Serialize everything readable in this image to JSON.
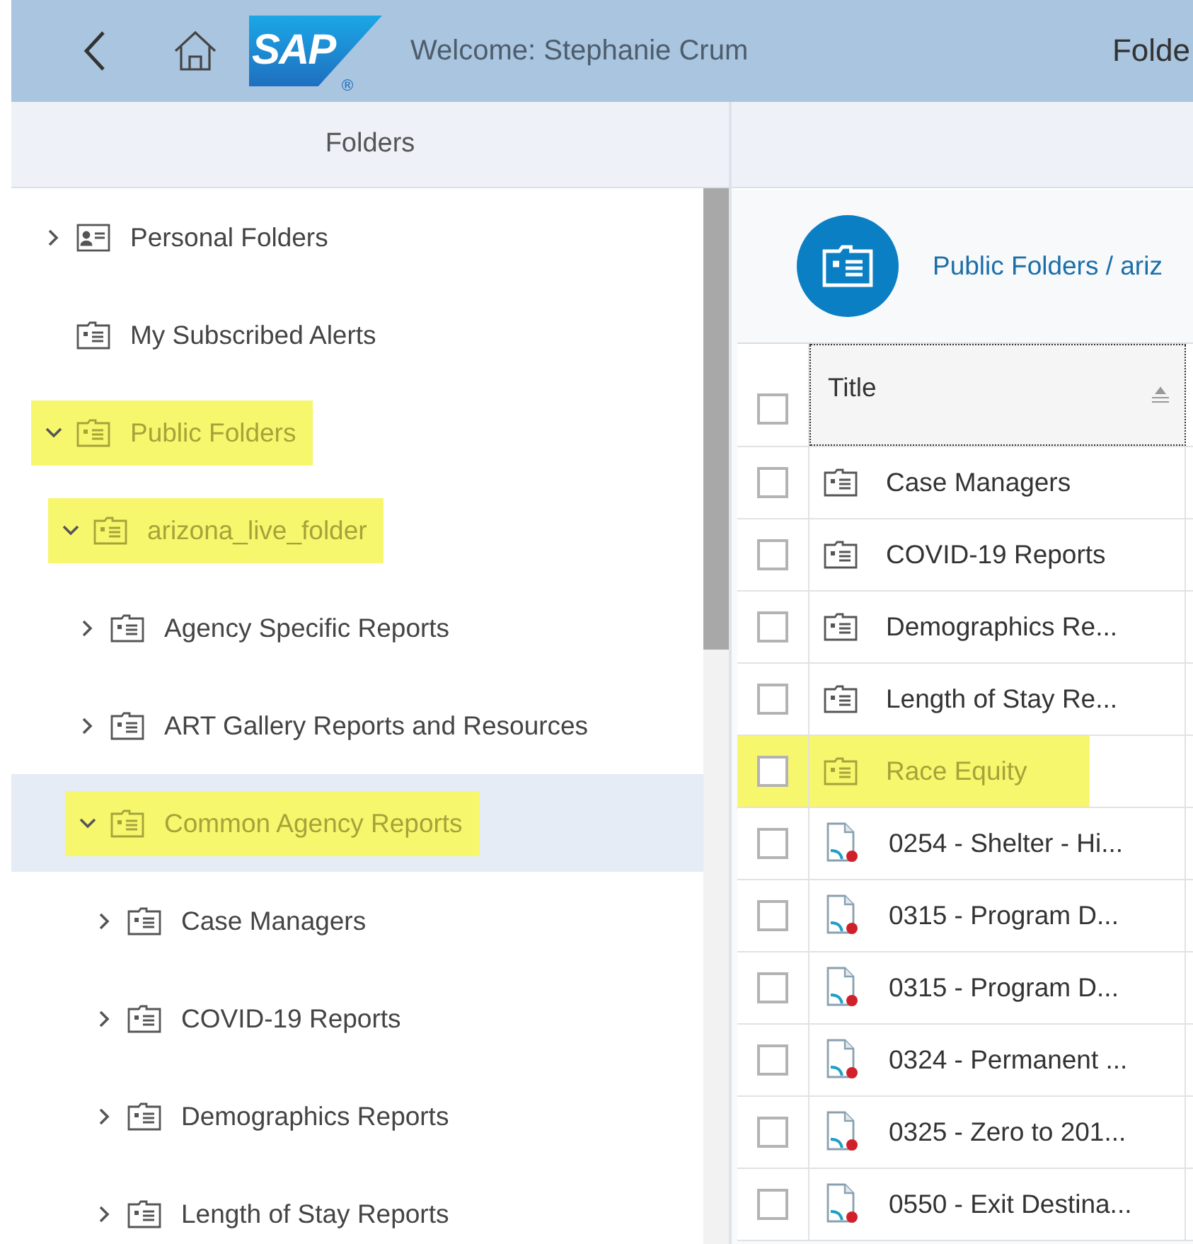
{
  "header": {
    "logo": "SAP",
    "logo_mark": "®",
    "welcome": "Welcome: Stephanie Crum",
    "title": "Folde"
  },
  "sidebar": {
    "title": "Folders",
    "tree": [
      {
        "label": "Personal Folders",
        "kind": "person",
        "has_children": true,
        "expanded": false,
        "highlighted": false,
        "selected": false
      },
      {
        "label": "My Subscribed Alerts",
        "kind": "folder",
        "has_children": false,
        "highlighted": false,
        "selected": false
      },
      {
        "label": "Public Folders",
        "kind": "folder",
        "has_children": true,
        "expanded": true,
        "highlighted": true,
        "selected": false,
        "children": [
          {
            "label": "arizona_live_folder",
            "kind": "folder",
            "has_children": true,
            "expanded": true,
            "highlighted": true,
            "selected": false,
            "children": [
              {
                "label": "Agency Specific Reports",
                "kind": "folder",
                "has_children": true,
                "expanded": false,
                "highlighted": false,
                "selected": false
              },
              {
                "label": "ART Gallery Reports and Resources",
                "kind": "folder",
                "has_children": true,
                "expanded": false,
                "highlighted": false,
                "selected": false
              },
              {
                "label": "Common Agency Reports",
                "kind": "folder",
                "has_children": true,
                "expanded": true,
                "highlighted": true,
                "selected": true,
                "children": [
                  {
                    "label": "Case Managers",
                    "kind": "folder",
                    "has_children": true,
                    "expanded": false,
                    "highlighted": false,
                    "selected": false
                  },
                  {
                    "label": "COVID-19 Reports",
                    "kind": "folder",
                    "has_children": true,
                    "expanded": false,
                    "highlighted": false,
                    "selected": false
                  },
                  {
                    "label": "Demographics Reports",
                    "kind": "folder",
                    "has_children": true,
                    "expanded": false,
                    "highlighted": false,
                    "selected": false
                  },
                  {
                    "label": "Length of Stay Reports",
                    "kind": "folder",
                    "has_children": true,
                    "expanded": false,
                    "highlighted": false,
                    "selected": false
                  }
                ]
              }
            ]
          }
        ]
      }
    ]
  },
  "content": {
    "breadcrumb": "Public Folders / ariz",
    "table": {
      "columns": [
        "Title"
      ],
      "header_checked": false,
      "rows": [
        {
          "title": "Case Managers",
          "kind": "folder",
          "checked": false,
          "highlighted": false
        },
        {
          "title": "COVID-19 Reports",
          "kind": "folder",
          "checked": false,
          "highlighted": false
        },
        {
          "title": "Demographics Re...",
          "kind": "folder",
          "checked": false,
          "highlighted": false
        },
        {
          "title": "Length of Stay Re...",
          "kind": "folder",
          "checked": false,
          "highlighted": false
        },
        {
          "title": "Race Equity",
          "kind": "folder",
          "checked": false,
          "highlighted": true
        },
        {
          "title": "0254 - Shelter - Hi...",
          "kind": "report",
          "checked": false,
          "highlighted": false
        },
        {
          "title": "0315 - Program D...",
          "kind": "report",
          "checked": false,
          "highlighted": false
        },
        {
          "title": "0315 - Program D...",
          "kind": "report",
          "checked": false,
          "highlighted": false
        },
        {
          "title": "0324 - Permanent ...",
          "kind": "report",
          "checked": false,
          "highlighted": false
        },
        {
          "title": "0325 - Zero to 201...",
          "kind": "report",
          "checked": false,
          "highlighted": false
        },
        {
          "title": "0550 - Exit Destina...",
          "kind": "report",
          "checked": false,
          "highlighted": false
        }
      ]
    }
  }
}
